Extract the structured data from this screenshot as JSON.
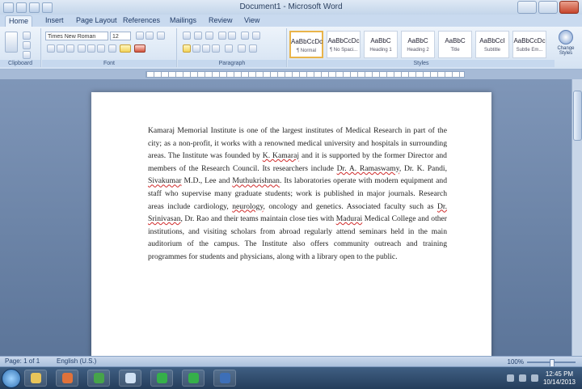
{
  "window": {
    "title": "Document1 - Microsoft Word"
  },
  "tabs": [
    {
      "label": "Home",
      "active": true
    },
    {
      "label": "Insert",
      "active": false
    },
    {
      "label": "Page Layout",
      "active": false
    },
    {
      "label": "References",
      "active": false
    },
    {
      "label": "Mailings",
      "active": false
    },
    {
      "label": "Review",
      "active": false
    },
    {
      "label": "View",
      "active": false
    }
  ],
  "ribbon": {
    "groups": {
      "clipboard": "Clipboard",
      "font": "Font",
      "paragraph": "Paragraph",
      "styles": "Styles"
    },
    "font_name": "Times New Roman",
    "font_size": "12",
    "styles": [
      {
        "sample": "AaBbCcDc",
        "name": "¶ Normal"
      },
      {
        "sample": "AaBbCcDc",
        "name": "¶ No Spaci..."
      },
      {
        "sample": "AaBbC",
        "name": "Heading 1"
      },
      {
        "sample": "AaBbC",
        "name": "Heading 2"
      },
      {
        "sample": "AaBbC",
        "name": "Title"
      },
      {
        "sample": "AaBbCcI",
        "name": "Subtitle"
      },
      {
        "sample": "AaBbCcDc",
        "name": "Subtle Em..."
      }
    ],
    "change_styles_label": "Change Styles",
    "highlight_color": "#f2d35a",
    "font_color": "#d2533c"
  },
  "document": {
    "paragraph_parts": [
      {
        "text": "Kamaraj Memorial Institute is one of the largest institutes of Medical Research in part of the city; as a non-profit, it works with a renowned medical university and hospitals in surrounding areas. The Institute was founded by ",
        "err": false
      },
      {
        "text": "K. Kamaraj",
        "err": true
      },
      {
        "text": " and it is supported by the former Director and members of the Research Council. Its researchers include ",
        "err": false
      },
      {
        "text": "Dr. A. Ramaswamy",
        "err": true
      },
      {
        "text": ", Dr. K. Pandi, ",
        "err": false
      },
      {
        "text": "Sivakumar",
        "err": true
      },
      {
        "text": " M.D., Lee and ",
        "err": false
      },
      {
        "text": "Muthukrishnan",
        "err": true
      },
      {
        "text": ". Its laboratories operate with modern equipment and staff who supervise many graduate students; work is published in major journals. Research areas include cardiology, ",
        "err": false
      },
      {
        "text": "neurology",
        "err": true
      },
      {
        "text": ", oncology and genetics. Associated faculty such as ",
        "err": false
      },
      {
        "text": "Dr. Srinivasan",
        "err": true
      },
      {
        "text": ", Dr. Rao and their teams maintain close ties with ",
        "err": false
      },
      {
        "text": "Madurai",
        "err": true
      },
      {
        "text": " Medical College and other institutions, and visiting scholars from abroad regularly attend seminars held in the main auditorium of the campus. The Institute also offers community outreach and training programmes for students and physicians, along with a library open to the public.",
        "err": false
      }
    ]
  },
  "status": {
    "page": "Page: 1 of 1",
    "language": "English (U.S.)",
    "zoom": "100%",
    "zoom_level_pct": 100
  },
  "taskbar": {
    "apps": [
      {
        "name": "explorer",
        "color": "#e8c45a"
      },
      {
        "name": "media",
        "color": "#e0723a"
      },
      {
        "name": "chrome",
        "color": "#46a34a"
      },
      {
        "name": "notepad",
        "color": "#cfe0f2"
      },
      {
        "name": "app-green-1",
        "color": "#35b04a"
      },
      {
        "name": "app-green-2",
        "color": "#35b04a"
      },
      {
        "name": "word",
        "color": "#3d6fb8"
      }
    ],
    "time": "12:45 PM",
    "date": "10/14/2013"
  }
}
